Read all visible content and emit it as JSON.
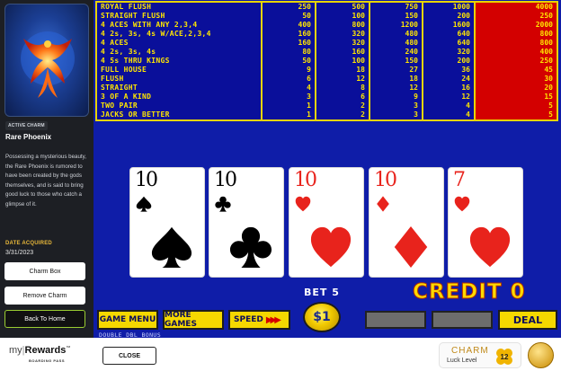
{
  "sidebar": {
    "active_badge": "ACTIVE CHARM",
    "charm_name": "Rare Phoenix",
    "description": "Possessing a mysterious beauty, the Rare Phoenix is rumored to have been created by the gods themselves, and is said to bring good luck to those who catch a glimpse of it.",
    "date_label": "DATE ACQUIRED",
    "date_value": "3/31/2023",
    "buttons": [
      "Charm Box",
      "Remove Charm",
      "Back To Home"
    ]
  },
  "paytable": {
    "hands": [
      "ROYAL FLUSH",
      "STRAIGHT FLUSH",
      "4 ACES WITH ANY 2,3,4",
      "4 2s, 3s, 4s W/ACE,2,3,4",
      "4 ACES",
      "4 2s, 3s, 4s",
      "4 5s THRU KINGS",
      "FULL HOUSE",
      "FLUSH",
      "STRAIGHT",
      "3 OF A KIND",
      "TWO PAIR",
      "JACKS OR BETTER"
    ],
    "columns": [
      [
        "250",
        "50",
        "400",
        "160",
        "160",
        "80",
        "50",
        "9",
        "6",
        "4",
        "3",
        "1",
        "1"
      ],
      [
        "500",
        "100",
        "800",
        "320",
        "320",
        "160",
        "100",
        "18",
        "12",
        "8",
        "6",
        "2",
        "2"
      ],
      [
        "750",
        "150",
        "1200",
        "480",
        "480",
        "240",
        "150",
        "27",
        "18",
        "12",
        "9",
        "3",
        "3"
      ],
      [
        "1000",
        "200",
        "1600",
        "640",
        "640",
        "320",
        "200",
        "36",
        "24",
        "16",
        "12",
        "4",
        "4"
      ],
      [
        "4000",
        "250",
        "2000",
        "800",
        "800",
        "400",
        "250",
        "45",
        "30",
        "20",
        "15",
        "5",
        "5"
      ]
    ],
    "highlight_column": 4
  },
  "cards": [
    {
      "rank": "10",
      "suit": "spade",
      "color": "#000000"
    },
    {
      "rank": "10",
      "suit": "club",
      "color": "#000000"
    },
    {
      "rank": "10",
      "suit": "heart",
      "color": "#e8231c"
    },
    {
      "rank": "10",
      "suit": "diamond",
      "color": "#e8231c"
    },
    {
      "rank": "7",
      "suit": "heart",
      "color": "#e8231c"
    }
  ],
  "controls": {
    "bet_label": "BET 5",
    "credit_label": "CREDIT 0",
    "coin_label": "$1",
    "game_menu": "GAME MENU",
    "more_games": "MORE GAMES",
    "speed": "SPEED",
    "deal": "DEAL",
    "game_title": "DOUBLE DBL BONUS"
  },
  "bottom": {
    "logo_my": "my",
    "logo_rewards": "Rewards",
    "logo_tm": "™",
    "logo_sub": "BOARDING PASS",
    "close": "CLOSE",
    "luck_title": "CHARM",
    "luck_sub": "Luck Level",
    "luck_level": "12"
  },
  "colors": {
    "felt": "#0f1da8",
    "paytable_text": "#ffe600",
    "highlight": "#d30000",
    "button_yellow": "#f5d800"
  }
}
